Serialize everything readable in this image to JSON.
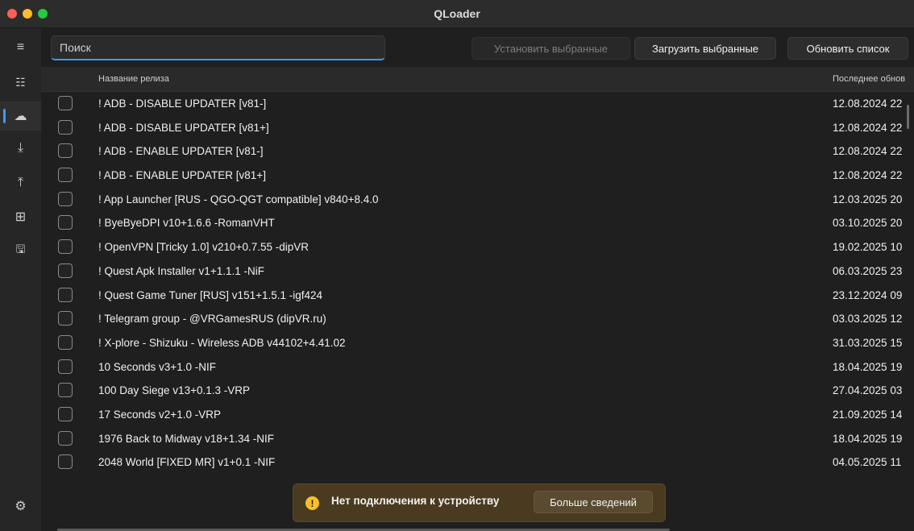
{
  "window": {
    "title": "QLoader"
  },
  "sidebar": {
    "items": [
      {
        "name": "menu-icon",
        "glyph": "≡"
      },
      {
        "name": "list-icon",
        "glyph": "☷"
      },
      {
        "name": "cloud-icon",
        "glyph": "☁"
      },
      {
        "name": "download-icon",
        "glyph": "⤓"
      },
      {
        "name": "upload-icon",
        "glyph": "⤒"
      },
      {
        "name": "apps-icon",
        "glyph": "⊞"
      },
      {
        "name": "save-icon",
        "glyph": "🖫"
      },
      {
        "name": "settings-icon",
        "glyph": "⚙"
      }
    ]
  },
  "toolbar": {
    "search_placeholder": "Поиск",
    "search_value": "",
    "install_selected": "Установить выбранные",
    "download_selected": "Загрузить выбранные",
    "refresh_list": "Обновить список"
  },
  "table": {
    "headers": {
      "name": "Название релиза",
      "updated": "Последнее обнов"
    },
    "rows": [
      {
        "name": "! ADB - DISABLE UPDATER [v81-]",
        "date": "12.08.2024 22"
      },
      {
        "name": "! ADB - DISABLE UPDATER [v81+]",
        "date": "12.08.2024 22"
      },
      {
        "name": "! ADB - ENABLE UPDATER [v81-]",
        "date": "12.08.2024 22"
      },
      {
        "name": "! ADB - ENABLE UPDATER [v81+]",
        "date": "12.08.2024 22"
      },
      {
        "name": "! App Launcher [RUS - QGO-QGT compatible] v840+8.4.0",
        "date": "12.03.2025 20"
      },
      {
        "name": "! ByeByeDPI v10+1.6.6 -RomanVHT",
        "date": "03.10.2025 20"
      },
      {
        "name": "! OpenVPN [Tricky 1.0] v210+0.7.55 -dipVR",
        "date": "19.02.2025 10"
      },
      {
        "name": "! Quest Apk Installer v1+1.1.1 -NiF",
        "date": "06.03.2025 23"
      },
      {
        "name": "! Quest Game Tuner [RUS] v151+1.5.1 -igf424",
        "date": "23.12.2024 09"
      },
      {
        "name": "! Telegram group - @VRGamesRUS (dipVR.ru)",
        "date": "03.03.2025 12"
      },
      {
        "name": "! X-plore - Shizuku - Wireless ADB v44102+4.41.02",
        "date": "31.03.2025 15"
      },
      {
        "name": "10 Seconds v3+1.0 -NIF",
        "date": "18.04.2025 19"
      },
      {
        "name": "100 Day Siege v13+0.1.3 -VRP",
        "date": "27.04.2025 03"
      },
      {
        "name": "17 Seconds v2+1.0 -VRP",
        "date": "21.09.2025 14"
      },
      {
        "name": "1976 Back to Midway v18+1.34 -NIF",
        "date": "18.04.2025 19"
      },
      {
        "name": "2048 World [FIXED MR] v1+0.1 -NIF",
        "date": "04.05.2025 11"
      }
    ]
  },
  "toast": {
    "message": "Нет подключения к устройству",
    "action": "Больше сведений",
    "icon": "warning-icon",
    "color": "#f7c02c"
  },
  "colors": {
    "accent": "#3b9cf0",
    "background": "#1f1f1f"
  }
}
